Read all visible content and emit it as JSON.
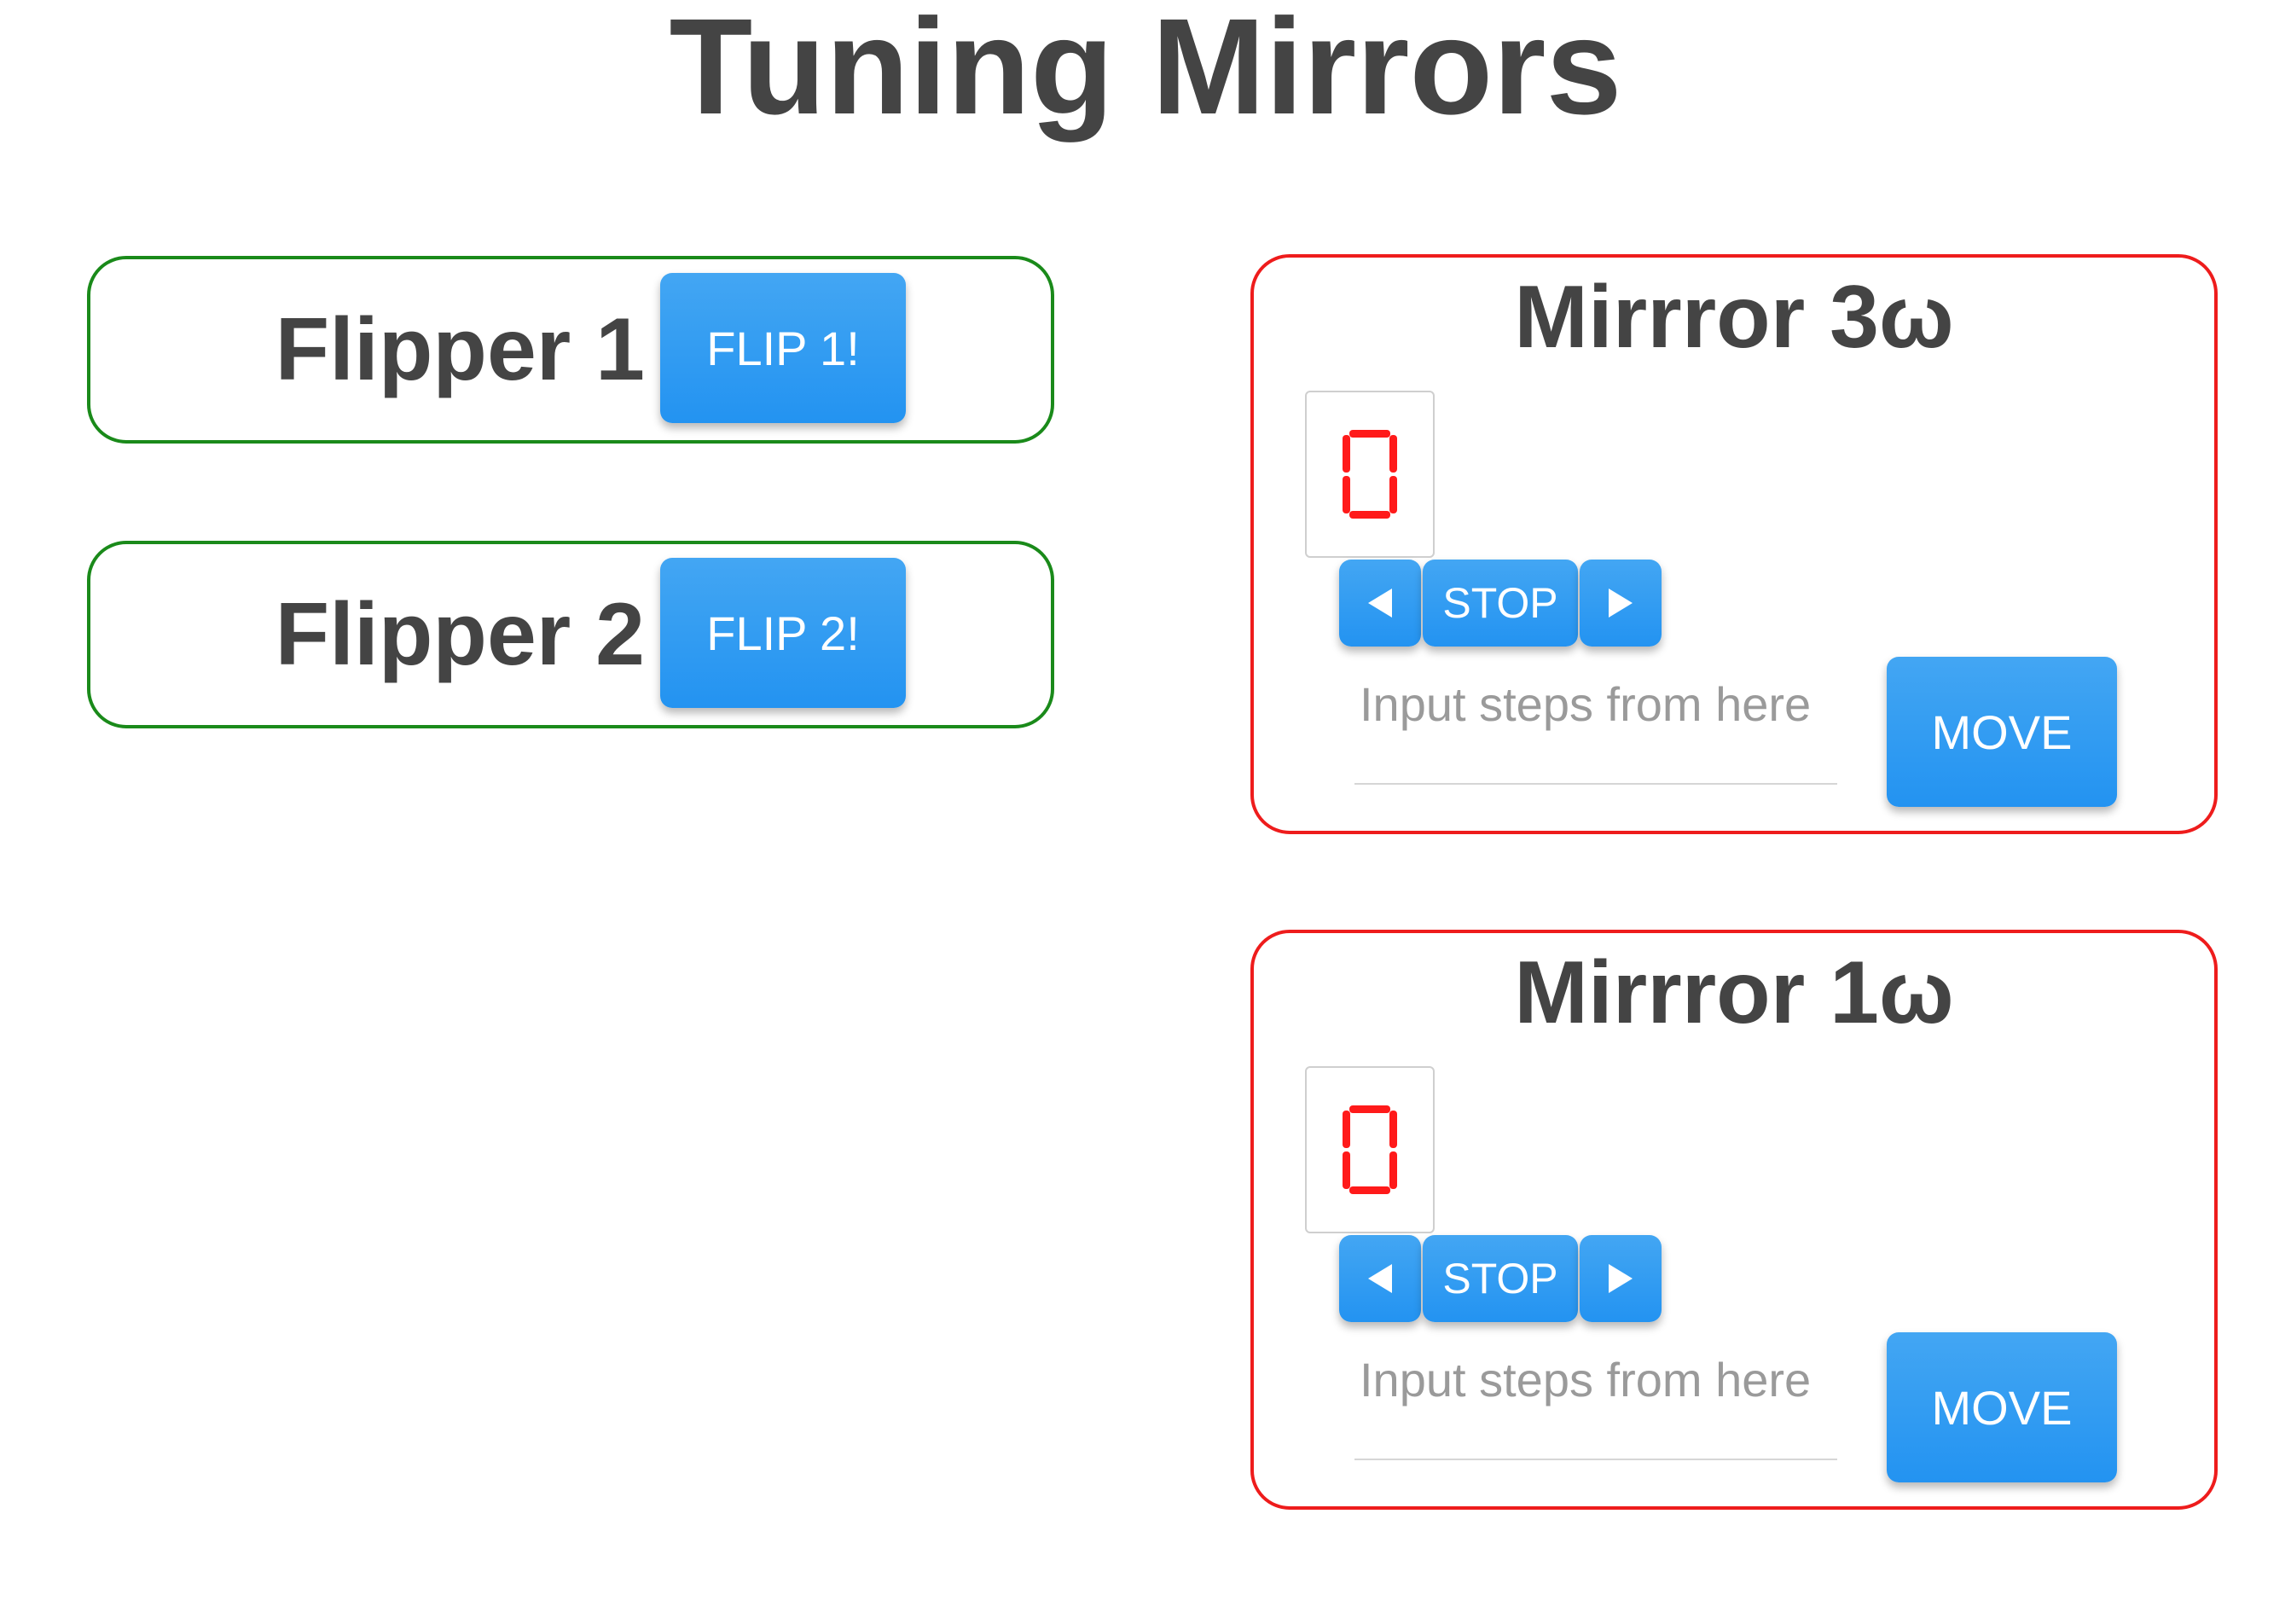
{
  "page": {
    "title": "Tuning Mirrors"
  },
  "flippers": [
    {
      "label": "Flipper 1",
      "button_label": "FLIP 1!"
    },
    {
      "label": "Flipper 2",
      "button_label": "FLIP 2!"
    }
  ],
  "mirrors": [
    {
      "title": "Mirrror 3ω",
      "position_readout": "0",
      "stop_label": "STOP",
      "left_icon": "triangle-left-icon",
      "right_icon": "triangle-right-icon",
      "steps_placeholder": "Input steps from here",
      "steps_value": "",
      "move_label": "MOVE"
    },
    {
      "title": "Mirrror 1ω",
      "position_readout": "0",
      "stop_label": "STOP",
      "left_icon": "triangle-left-icon",
      "right_icon": "triangle-right-icon",
      "steps_placeholder": "Input steps from here",
      "steps_value": "",
      "move_label": "MOVE"
    }
  ],
  "colors": {
    "text": "#444444",
    "button_blue": "#2196f3",
    "flipper_border": "#1a8a1a",
    "mirror_border": "#ee1c1c",
    "readout_digit": "#ff1a1a"
  }
}
